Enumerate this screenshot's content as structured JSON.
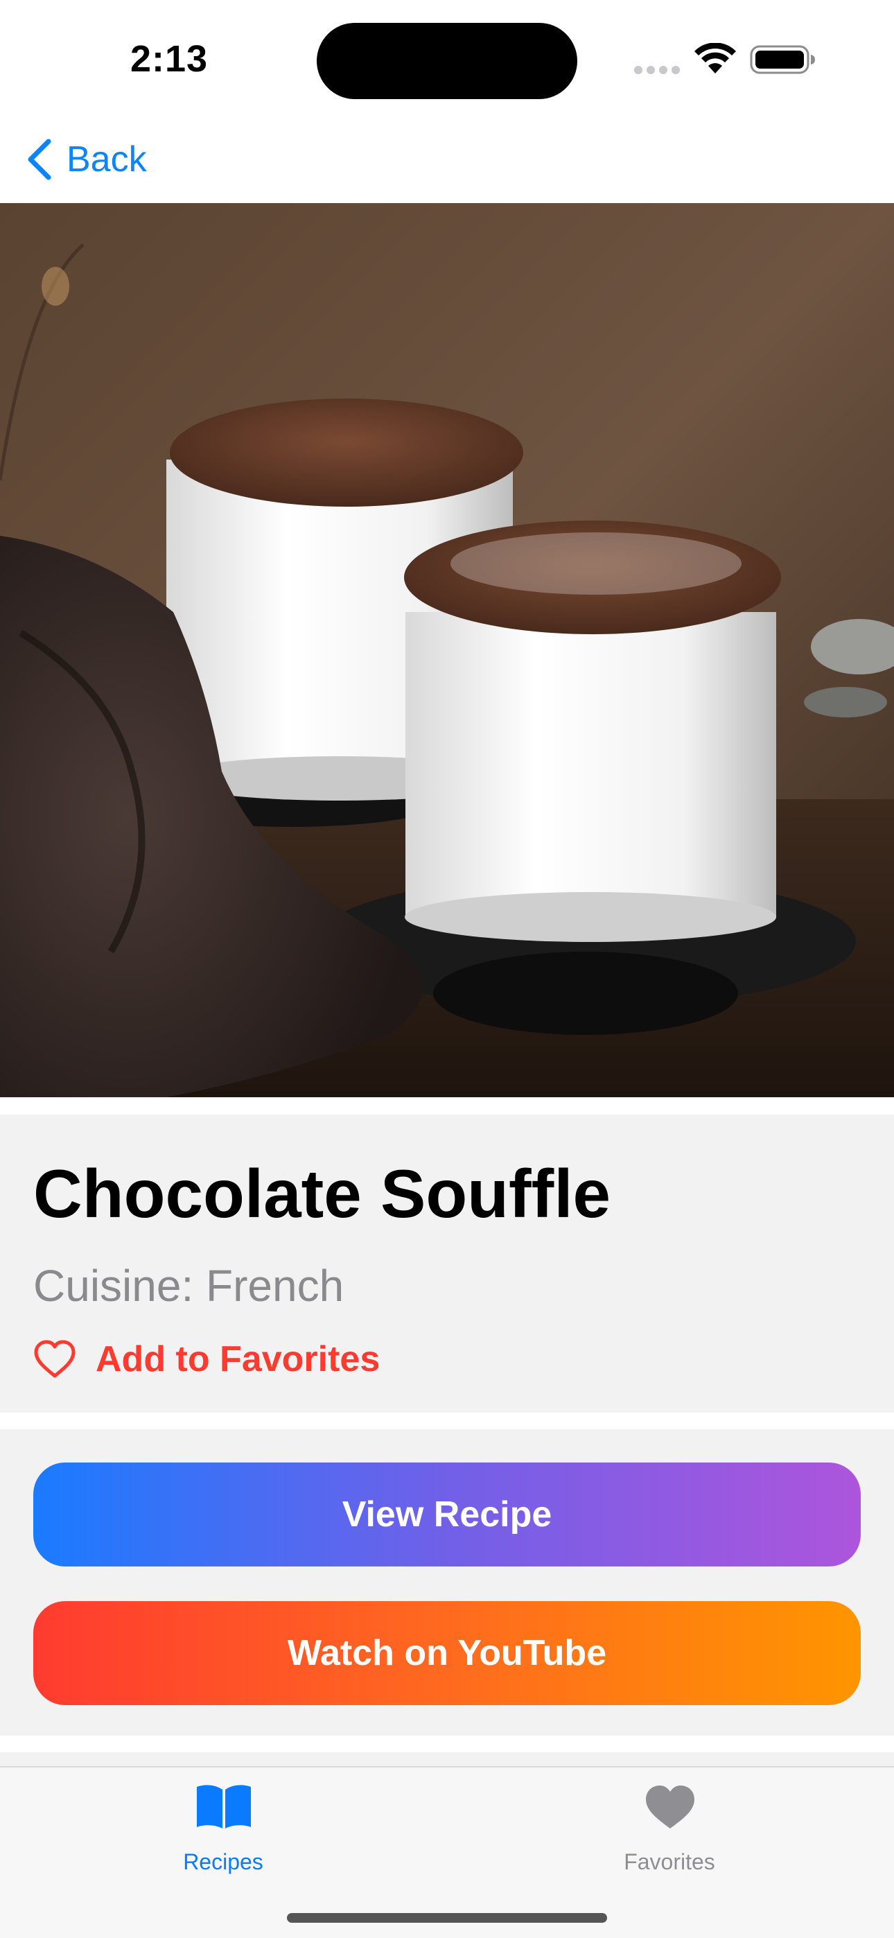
{
  "status_bar": {
    "time": "2:13",
    "wifi_icon": "wifi-icon",
    "battery_icon": "battery-icon"
  },
  "nav": {
    "back_label": "Back",
    "back_icon": "chevron-left-icon"
  },
  "recipe": {
    "image_alt_semantic": "chocolate-souffle-photo",
    "title": "Chocolate Souffle",
    "cuisine": "Cuisine: French",
    "favorite_label": "Add to Favorites",
    "favorite_icon": "heart-outline-icon"
  },
  "actions": {
    "view_recipe_label": "View Recipe",
    "watch_youtube_label": "Watch on YouTube"
  },
  "tab_bar": {
    "tabs": [
      {
        "label": "Recipes",
        "icon": "book-icon",
        "selected": true
      },
      {
        "label": "Favorites",
        "icon": "heart-filled-icon",
        "selected": false
      }
    ]
  },
  "colors": {
    "accent_blue": "#0a84ff",
    "favorite_red": "#ff3b30",
    "view_gradient": [
      "#1a7bff",
      "#ad55dc"
    ],
    "youtube_gradient": [
      "#ff3b30",
      "#ff9500"
    ],
    "card_bg": "#f2f2f2"
  }
}
